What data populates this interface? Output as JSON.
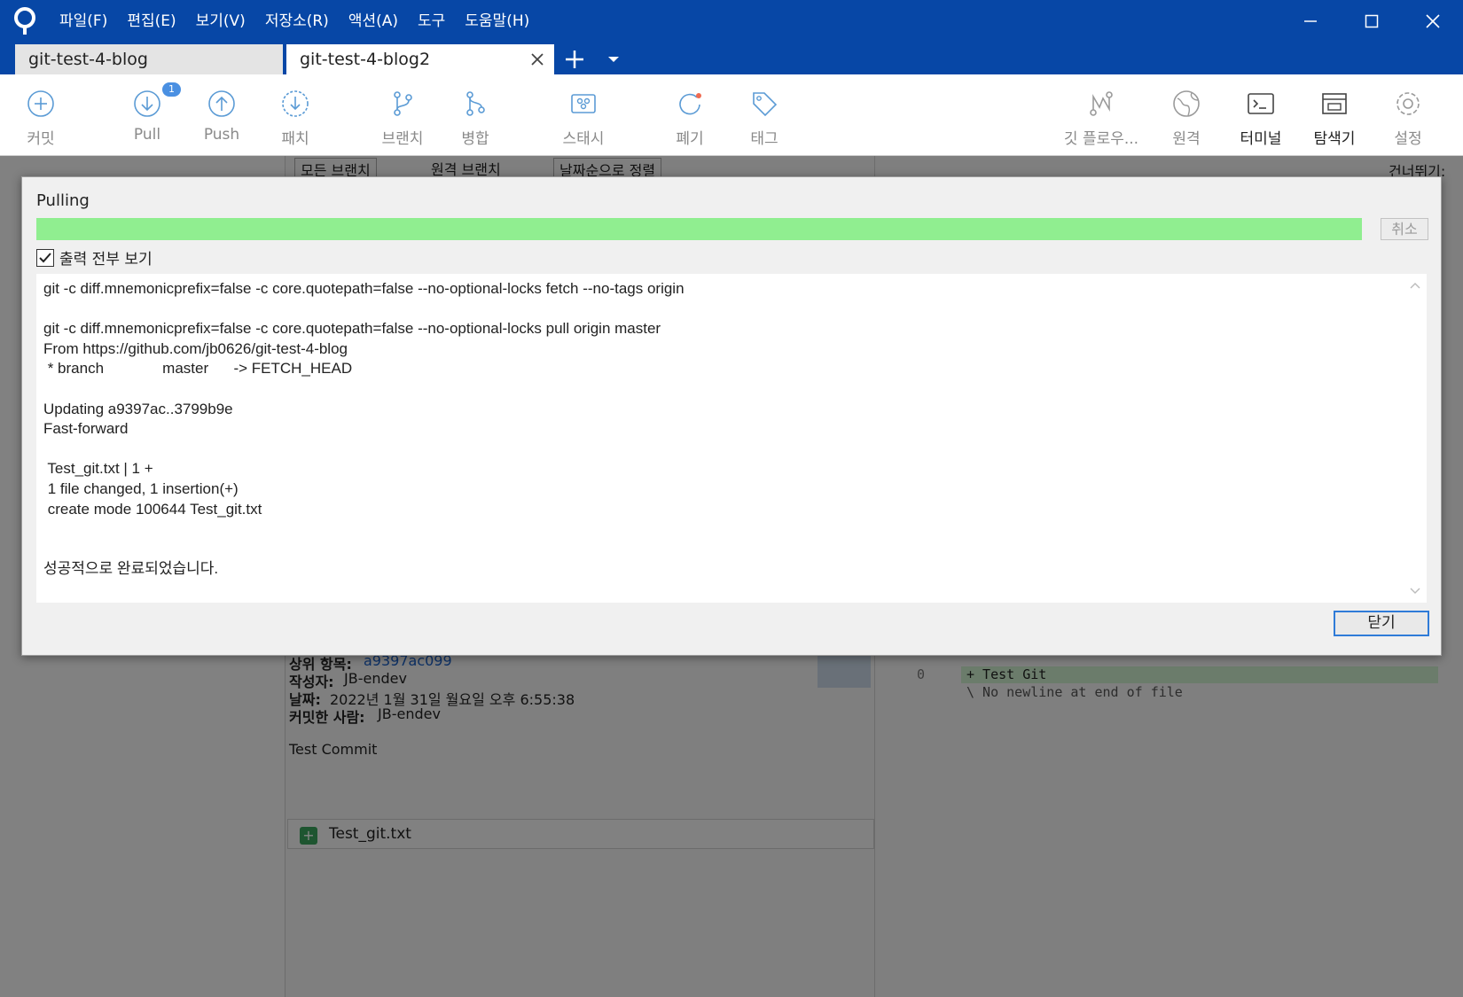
{
  "menu": {
    "items": [
      "파일(F)",
      "편집(E)",
      "보기(V)",
      "저장소(R)",
      "액션(A)",
      "도구",
      "도움말(H)"
    ]
  },
  "tabs": [
    {
      "label": "git-test-4-blog"
    },
    {
      "label": "git-test-4-blog2"
    }
  ],
  "toolbar": {
    "commit": "커밋",
    "pull": "Pull",
    "pull_badge": "1",
    "push": "Push",
    "patch": "패치",
    "branch": "브랜치",
    "merge": "병합",
    "stash": "스태시",
    "discard": "폐기",
    "tag": "태그",
    "gitflow": "깃 플로우...",
    "remote": "원격",
    "terminal": "터미널",
    "explorer": "탐색기",
    "settings": "설정"
  },
  "filters": {
    "all_branches": "모든 브랜치",
    "remote_branches": "원격 브랜치",
    "sort": "날짜순으로 정렬",
    "jump": "건너뛰기:"
  },
  "commit_details": {
    "parent_label": "상위 항목:",
    "parent_value": "a9397ac099",
    "author_label": "작성자:",
    "author_value": "JB-endev",
    "date_label": "날짜:",
    "date_value": "2022년 1월 31일 월요일 오후 6:55:38",
    "committer_label": "커밋한 사람:",
    "committer_value": "JB-endev",
    "message": "Test Commit",
    "file": "Test_git.txt"
  },
  "diff": {
    "line_number": "0",
    "added_line": "+ Test Git",
    "no_newline": "\\  No newline at end of file"
  },
  "dialog": {
    "title": "Pulling",
    "progress": 1.0,
    "cancel": "취소",
    "show_output": "출력 전부 보기",
    "output_lines": [
      "git -c diff.mnemonicprefix=false -c core.quotepath=false --no-optional-locks fetch --no-tags origin",
      "",
      "git -c diff.mnemonicprefix=false -c core.quotepath=false --no-optional-locks pull origin master",
      "From https://github.com/jb0626/git-test-4-blog",
      " * branch              master      -> FETCH_HEAD",
      "",
      "Updating a9397ac..3799b9e",
      "Fast-forward",
      "",
      " Test_git.txt | 1 +",
      " 1 file changed, 1 insertion(+)",
      " create mode 100644 Test_git.txt",
      "",
      "",
      "성공적으로 완료되었습니다."
    ],
    "close": "닫기"
  },
  "colors": {
    "titlebar": "#0747a6",
    "progress": "#90ee90",
    "accent": "#2f7bd8"
  }
}
